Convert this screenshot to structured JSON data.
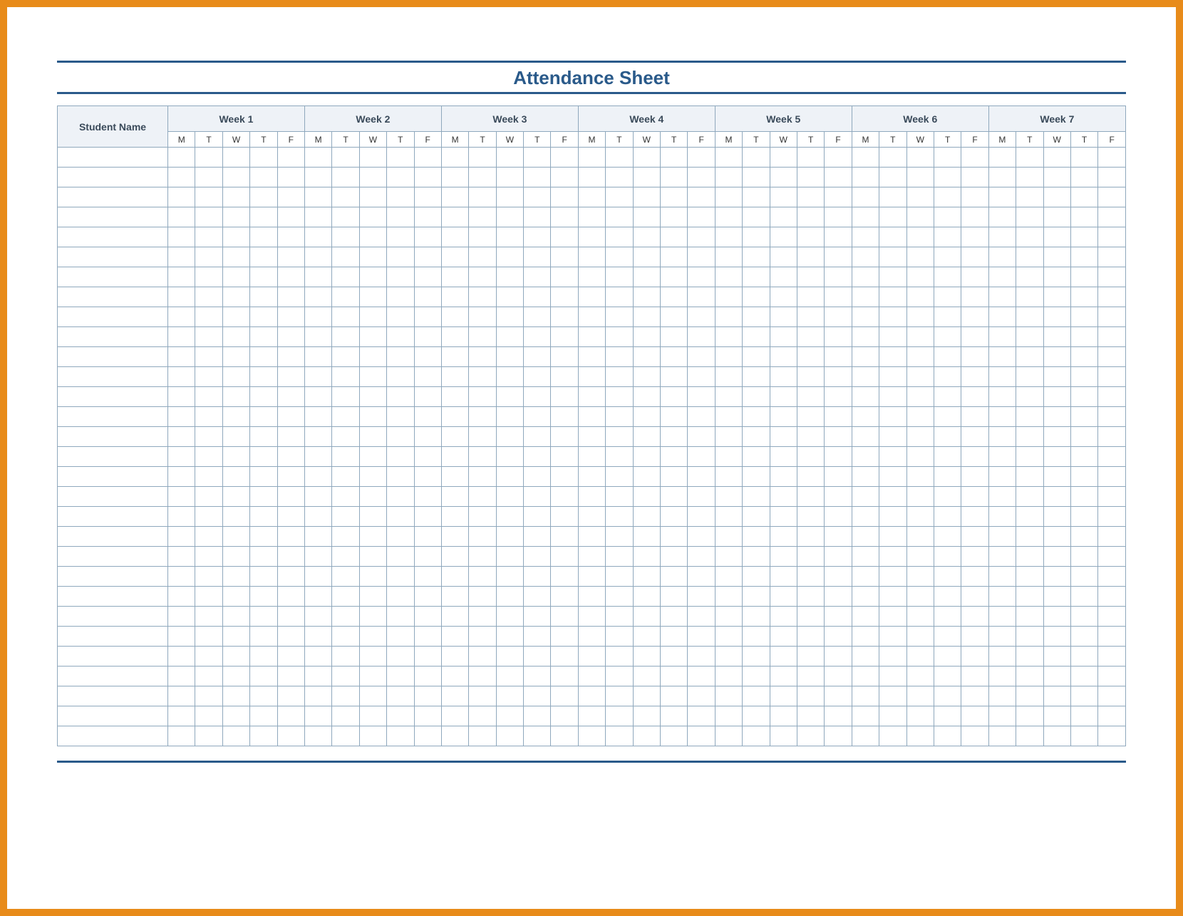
{
  "title": "Attendance Sheet",
  "columns": {
    "name_header": "Student Name",
    "weeks": [
      "Week 1",
      "Week 2",
      "Week 3",
      "Week 4",
      "Week 5",
      "Week 6",
      "Week 7"
    ],
    "days": [
      "M",
      "T",
      "W",
      "T",
      "F"
    ]
  },
  "row_count": 30,
  "colors": {
    "frame": "#e88b1a",
    "rule": "#2a5a8a",
    "title": "#2a5a8a",
    "header_bg": "#eef2f7",
    "grid_border": "#8fa8bd"
  }
}
